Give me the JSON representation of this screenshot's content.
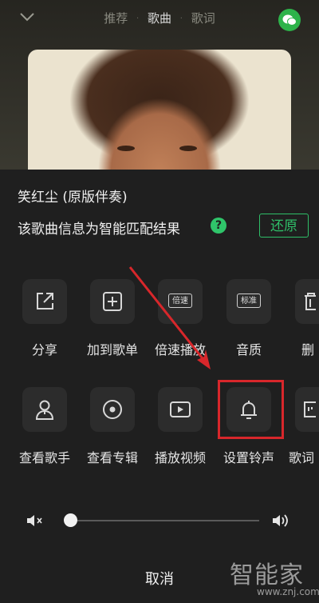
{
  "tabs": [
    {
      "label": "推荐",
      "active": false
    },
    {
      "label": "歌曲",
      "active": true
    },
    {
      "label": "歌词",
      "active": false
    }
  ],
  "tab_separator": "·",
  "song": {
    "title": "笑红尘 (原版伴奏)"
  },
  "match": {
    "text": "该歌曲信息为智能匹配结果",
    "help_icon": "?",
    "restore_label": "还原"
  },
  "actions_row1": [
    {
      "icon": "share-icon",
      "label": "分享"
    },
    {
      "icon": "add-to-playlist-icon",
      "label": "加到歌单"
    },
    {
      "icon": "speed-badge-icon",
      "badge": "倍速",
      "label": "倍速播放"
    },
    {
      "icon": "quality-badge-icon",
      "badge": "标准",
      "label": "音质"
    },
    {
      "icon": "trash-icon",
      "label": "删"
    }
  ],
  "actions_row2": [
    {
      "icon": "singer-icon",
      "label": "查看歌手"
    },
    {
      "icon": "album-icon",
      "label": "查看专辑"
    },
    {
      "icon": "video-play-icon",
      "label": "播放视频"
    },
    {
      "icon": "bell-icon",
      "label": "设置铃声"
    },
    {
      "icon": "lyrics-poster-icon",
      "label": "歌词"
    }
  ],
  "volume": {
    "level": 0.0
  },
  "cancel_label": "取消",
  "watermark": {
    "text": "智能家",
    "url": "www.znj.com"
  },
  "colors": {
    "accent_green": "#2fbe68",
    "highlight_red": "#d8272b",
    "panel_bg": "#1f1f1f"
  }
}
